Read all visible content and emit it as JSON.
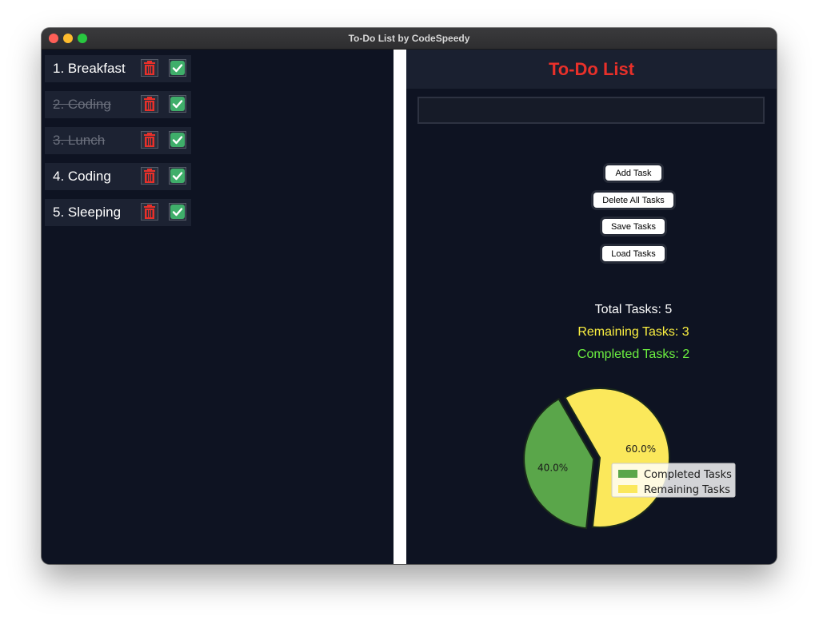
{
  "window": {
    "title": "To-Do List by CodeSpeedy"
  },
  "tasks": [
    {
      "label": "1. Breakfast",
      "completed": false
    },
    {
      "label": "2. Coding",
      "completed": true
    },
    {
      "label": "3. Lunch",
      "completed": true
    },
    {
      "label": "4. Coding",
      "completed": false
    },
    {
      "label": "5. Sleeping",
      "completed": false
    }
  ],
  "header": {
    "title": "To-Do List"
  },
  "input": {
    "value": "",
    "placeholder": ""
  },
  "buttons": {
    "add": "Add Task",
    "delete_all": "Delete All Tasks",
    "save": "Save Tasks",
    "load": "Load Tasks"
  },
  "stats": {
    "total": "Total Tasks: 5",
    "remaining": "Remaining Tasks: 3",
    "completed": "Completed Tasks: 2"
  },
  "colors": {
    "accent_title": "#e8302a",
    "remaining": "#fcf040",
    "completed": "#6cf040",
    "pie_completed": "#5aa64a",
    "pie_remaining": "#fbe85b"
  },
  "chart_data": {
    "type": "pie",
    "categories": [
      "Completed Tasks",
      "Remaining Tasks"
    ],
    "values": [
      40.0,
      60.0
    ],
    "labels": [
      "40.0%",
      "60.0%"
    ],
    "legend_position": "right"
  }
}
